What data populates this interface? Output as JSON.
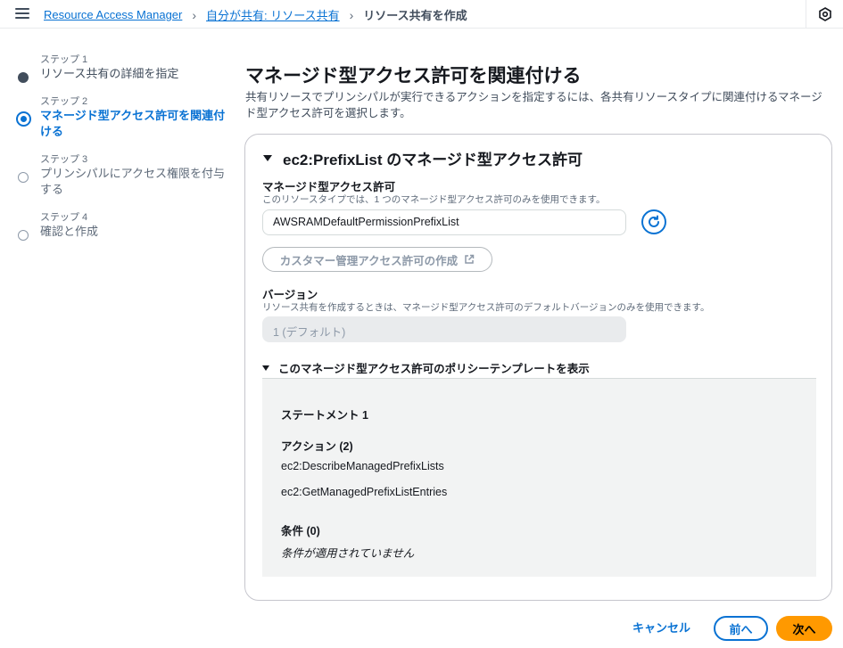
{
  "breadcrumb": {
    "items": [
      "Resource Access Manager",
      "自分が共有: リソース共有",
      "リソース共有を作成"
    ]
  },
  "steps": [
    {
      "number": "ステップ 1",
      "title": "リソース共有の詳細を指定",
      "state": "done"
    },
    {
      "number": "ステップ 2",
      "title": "マネージド型アクセス許可を関連付ける",
      "state": "active"
    },
    {
      "number": "ステップ 3",
      "title": "プリンシパルにアクセス権限を付与する",
      "state": "disabled"
    },
    {
      "number": "ステップ 4",
      "title": "確認と作成",
      "state": "disabled"
    }
  ],
  "page": {
    "title": "マネージド型アクセス許可を関連付ける",
    "description": "共有リソースでプリンシパルが実行できるアクションを指定するには、各共有リソースタイプに関連付けるマネージド型アクセス許可を選択します。"
  },
  "panel": {
    "title": "ec2:PrefixList のマネージド型アクセス許可",
    "permission_label": "マネージド型アクセス許可",
    "permission_hint": "このリソースタイプでは、1 つのマネージド型アクセス許可のみを使用できます。",
    "permission_value": "AWSRAMDefaultPermissionPrefixList",
    "create_button": "カスタマー管理アクセス許可の作成",
    "version_label": "バージョン",
    "version_hint": "リソース共有を作成するときは、マネージド型アクセス許可のデフォルトバージョンのみを使用できます。",
    "version_value": "1 (デフォルト)",
    "policy_toggle": "このマネージド型アクセス許可のポリシーテンプレートを表示",
    "policy": {
      "statement": "ステートメント 1",
      "actions_label": "アクション (2)",
      "actions": [
        "ec2:DescribeManagedPrefixLists",
        "ec2:GetManagedPrefixListEntries"
      ],
      "conditions_label": "条件 (0)",
      "conditions_text": "条件が適用されていません"
    }
  },
  "footer": {
    "cancel": "キャンセル",
    "prev": "前へ",
    "next": "次へ"
  },
  "colors": {
    "link": "#0972d3",
    "primary": "#ff9900"
  }
}
